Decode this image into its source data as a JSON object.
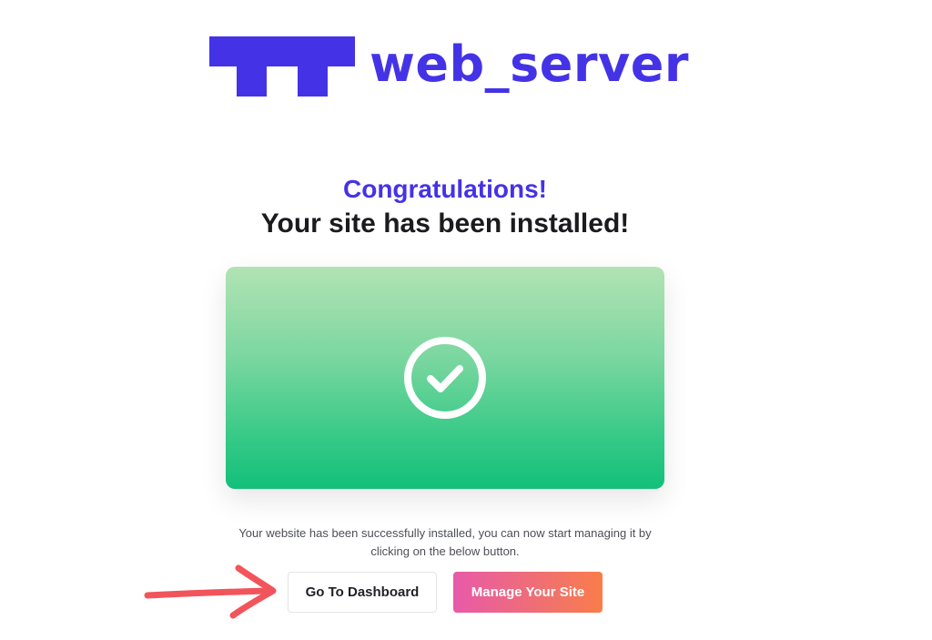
{
  "brand": {
    "name": "web_server",
    "color": "#4433e6"
  },
  "headline": {
    "accent": "Congratulations!",
    "main": "Your site has been installed!"
  },
  "hero": {
    "icon": "check-circle-icon",
    "gradient_top": "#b2e3b4",
    "gradient_bottom": "#12c07a"
  },
  "message": "Your website has been successfully installed, you can now start managing it by clicking on the below button.",
  "buttons": {
    "dashboard_label": "Go To Dashboard",
    "manage_label": "Manage Your Site"
  },
  "annotation": {
    "icon": "arrow-right-icon",
    "color": "#f2545b"
  }
}
